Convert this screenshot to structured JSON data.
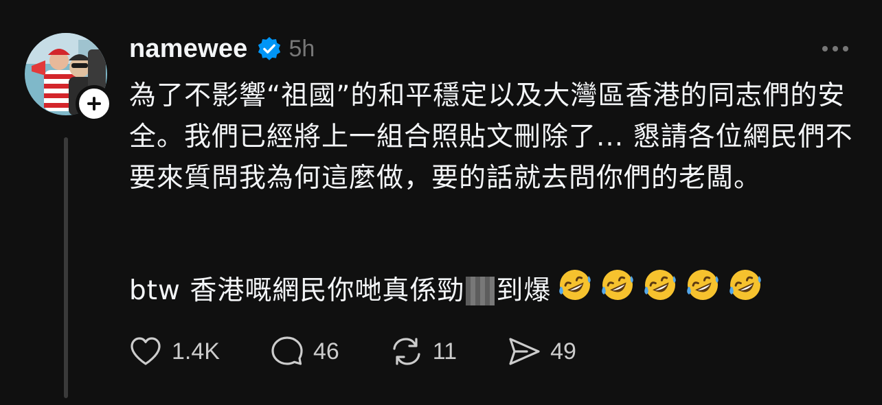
{
  "post": {
    "username": "namewee",
    "time": "5h",
    "text_main": "為了不影響“祖國”的和平穩定以及大灣區香港的同志們的安全。我們已經將上一組合照貼文刪除了... 懇請各位網民們不要來質問我為何這麼做，要的話就去問你們的老闆。",
    "text_second_before": "btw 香港嘅網民你哋真係勁",
    "text_second_after": "到爆",
    "emojis": [
      "🤣",
      "🤣",
      "🤣",
      "🤣",
      "🤣"
    ]
  },
  "actions": {
    "likes": "1.4K",
    "comments": "46",
    "reposts": "11",
    "shares": "49"
  },
  "icons": {
    "verified": "verified-badge-icon",
    "more": "more-options-icon",
    "like": "heart-icon",
    "comment": "comment-bubble-icon",
    "repost": "repost-icon",
    "share": "send-icon",
    "follow": "plus-icon"
  },
  "colors": {
    "background": "#101010",
    "text": "#f3f5f7",
    "muted": "#777777",
    "verified": "#0095f6"
  }
}
